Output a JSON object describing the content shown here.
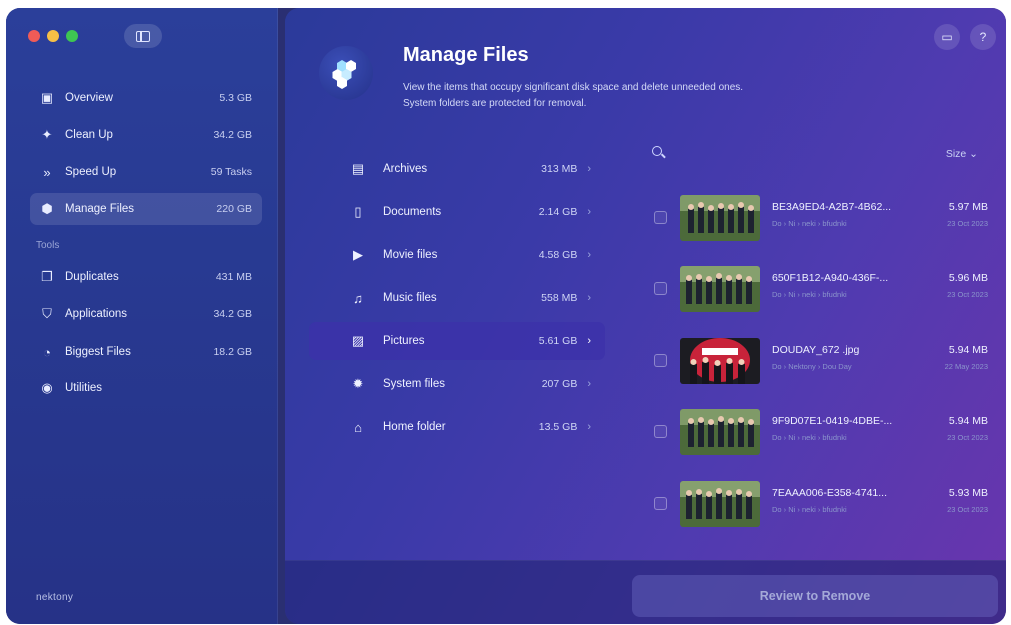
{
  "sidebar": {
    "items": [
      {
        "label": "Overview",
        "value": "5.3 GB",
        "icon": "overview-icon"
      },
      {
        "label": "Clean Up",
        "value": "34.2 GB",
        "icon": "broom-icon"
      },
      {
        "label": "Speed Up",
        "value": "59 Tasks",
        "icon": "speed-icon"
      },
      {
        "label": "Manage Files",
        "value": "220 GB",
        "icon": "manage-files-icon"
      }
    ],
    "section_label": "Tools",
    "tools": [
      {
        "label": "Duplicates",
        "value": "431 MB",
        "icon": "duplicates-icon"
      },
      {
        "label": "Applications",
        "value": "34.2 GB",
        "icon": "applications-icon"
      },
      {
        "label": "Biggest Files",
        "value": "18.2 GB",
        "icon": "biggest-files-icon"
      },
      {
        "label": "Utilities",
        "value": "",
        "icon": "utilities-icon"
      }
    ],
    "brand": "nektony"
  },
  "header": {
    "title": "Manage Files",
    "description_line1": "View the items that occupy significant disk space and delete unneeded ones.",
    "description_line2": "System folders are protected for removal."
  },
  "categories": [
    {
      "label": "Archives",
      "value": "313 MB"
    },
    {
      "label": "Documents",
      "value": "2.14 GB"
    },
    {
      "label": "Movie files",
      "value": "4.58 GB"
    },
    {
      "label": "Music files",
      "value": "558 MB"
    },
    {
      "label": "Pictures",
      "value": "5.61 GB"
    },
    {
      "label": "System files",
      "value": "207 GB"
    },
    {
      "label": "Home folder",
      "value": "13.5 GB"
    }
  ],
  "list": {
    "sort_label": "Size ⌄",
    "files": [
      {
        "name": "BE3A9ED4-A2B7-4B62...",
        "path": "Do › Ni › neki › bfudnki",
        "size": "5.97 MB",
        "date": "23 Oct 2023"
      },
      {
        "name": "650F1B12-A940-436F-...",
        "path": "Do › Ni › neki › bfudnki",
        "size": "5.96 MB",
        "date": "23 Oct 2023"
      },
      {
        "name": "DOUDAY_672 .jpg",
        "path": "Do › Nektony › Dou Day",
        "size": "5.94 MB",
        "date": "22 May 2023"
      },
      {
        "name": "9F9D07E1-0419-4DBE-...",
        "path": "Do › Ni › neki › bfudnki",
        "size": "5.94 MB",
        "date": "23 Oct 2023"
      },
      {
        "name": "7EAAA006-E358-4741...",
        "path": "Do › Ni › neki › bfudnki",
        "size": "5.93 MB",
        "date": "23 Oct 2023"
      }
    ]
  },
  "footer": {
    "review_button": "Review to Remove"
  }
}
